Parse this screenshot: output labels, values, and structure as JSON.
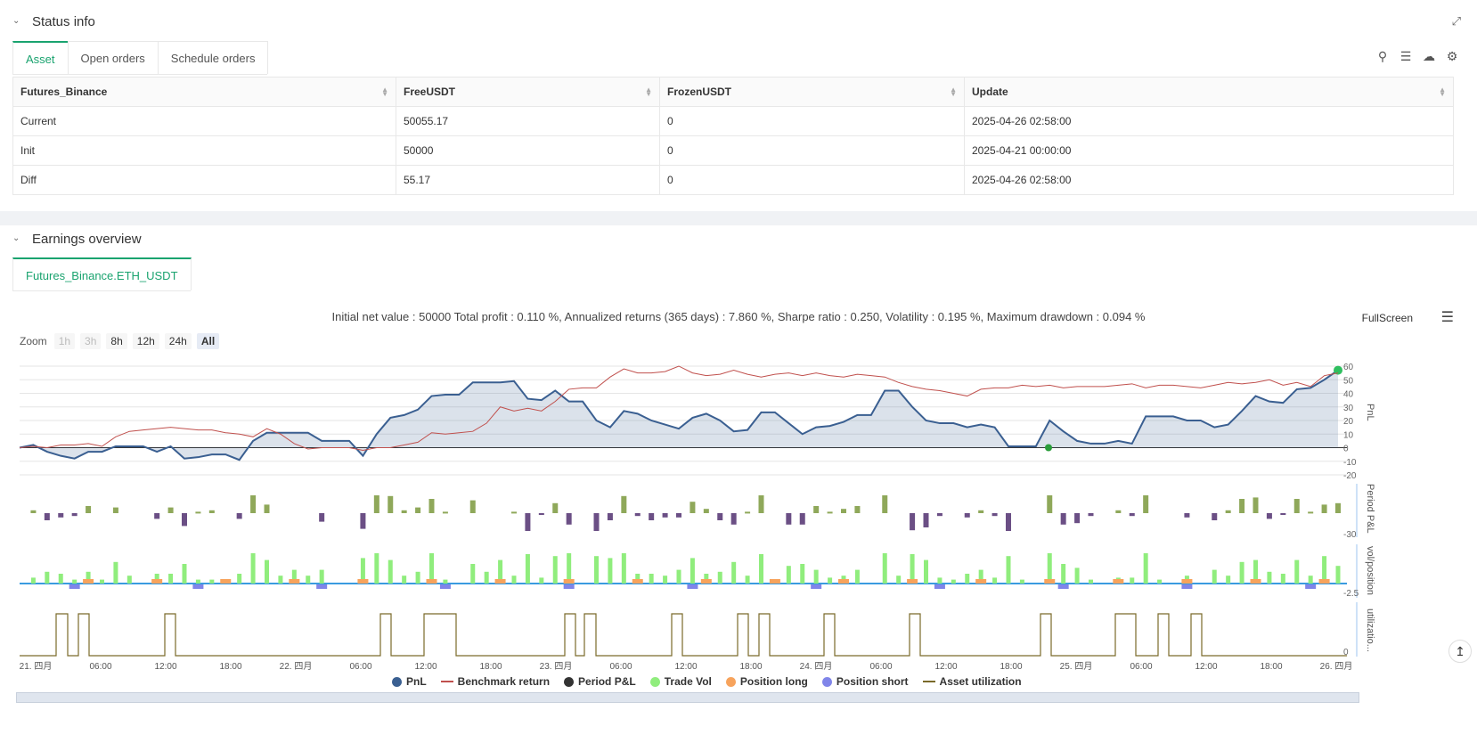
{
  "status": {
    "title": "Status info",
    "tabs": [
      {
        "label": "Asset",
        "active": true
      },
      {
        "label": "Open orders",
        "active": false
      },
      {
        "label": "Schedule orders",
        "active": false
      }
    ],
    "table": {
      "headers": [
        "Futures_Binance",
        "FreeUSDT",
        "FrozenUSDT",
        "Update"
      ],
      "rows": [
        [
          "Current",
          "50055.17",
          "0",
          "2025-04-26 02:58:00"
        ],
        [
          "Init",
          "50000",
          "0",
          "2025-04-21 00:00:00"
        ],
        [
          "Diff",
          "55.17",
          "0",
          "2025-04-26 02:58:00"
        ]
      ]
    }
  },
  "earnings": {
    "title": "Earnings overview",
    "tab": "Futures_Binance.ETH_USDT",
    "summary": "Initial net value : 50000 Total profit : 0.110 %, Annualized returns (365 days) : 7.860 %, Sharpe ratio : 0.250, Volatility : 0.195 %, Maximum drawdown : 0.094 %",
    "fullscreen": "FullScreen",
    "zoom_label": "Zoom",
    "zoom_buttons": [
      {
        "label": "1h",
        "state": "disabled"
      },
      {
        "label": "3h",
        "state": "disabled"
      },
      {
        "label": "8h",
        "state": "normal"
      },
      {
        "label": "12h",
        "state": "normal"
      },
      {
        "label": "24h",
        "state": "normal"
      },
      {
        "label": "All",
        "state": "selected"
      }
    ],
    "legend": [
      {
        "label": "PnL",
        "color": "#3a5f91",
        "shape": "dot"
      },
      {
        "label": "Benchmark return",
        "color": "#c0504d",
        "shape": "line"
      },
      {
        "label": "Period P&L",
        "color": "#333333",
        "shape": "dot"
      },
      {
        "label": "Trade Vol",
        "color": "#90ed7d",
        "shape": "dot"
      },
      {
        "label": "Position long",
        "color": "#f7a35c",
        "shape": "dot"
      },
      {
        "label": "Position short",
        "color": "#8085e9",
        "shape": "dot"
      },
      {
        "label": "Asset utilization",
        "color": "#7a6a2a",
        "shape": "line"
      }
    ]
  },
  "chart_data": {
    "type": "line",
    "x_ticks": [
      "21. 四月",
      "06:00",
      "12:00",
      "18:00",
      "22. 四月",
      "06:00",
      "12:00",
      "18:00",
      "23. 四月",
      "06:00",
      "12:00",
      "18:00",
      "24. 四月",
      "06:00",
      "12:00",
      "18:00",
      "25. 四月",
      "06:00",
      "12:00",
      "18:00",
      "26. 四月"
    ],
    "pnl_axis": {
      "label": "PnL",
      "ticks": [
        60,
        50,
        40,
        30,
        20,
        10,
        0,
        -10,
        -20
      ],
      "ylim": [
        -20,
        60
      ]
    },
    "period_axis": {
      "label": "Period P&L",
      "ticks": [
        -30
      ]
    },
    "vol_axis": {
      "label": "vol/position",
      "ticks": [
        -2.5
      ]
    },
    "util_axis": {
      "label": "utilizatio...",
      "ticks": [
        0
      ]
    },
    "pnl": [
      0,
      2,
      -3,
      -6,
      -8,
      -3,
      -3,
      1,
      1,
      1,
      -3,
      1,
      -8,
      -7,
      -5,
      -5,
      -9,
      5,
      11,
      11,
      11,
      11,
      5,
      5,
      5,
      -6,
      10,
      22,
      24,
      28,
      38,
      39,
      39,
      48,
      48,
      48,
      49,
      36,
      35,
      42,
      34,
      34,
      20,
      15,
      27,
      25,
      20,
      17,
      14,
      22,
      25,
      20,
      12,
      13,
      26,
      26,
      18,
      10,
      15,
      16,
      19,
      24,
      24,
      42,
      42,
      30,
      20,
      18,
      18,
      15,
      17,
      15,
      1,
      1,
      1,
      20,
      12,
      5,
      3,
      3,
      5,
      3,
      23,
      23,
      23,
      20,
      20,
      15,
      17,
      27,
      38,
      34,
      33,
      43,
      44,
      50,
      57
    ],
    "benchmark": [
      0,
      1,
      0,
      2,
      2,
      3,
      1,
      8,
      12,
      13,
      14,
      15,
      14,
      13,
      13,
      11,
      10,
      8,
      14,
      10,
      3,
      -1,
      0,
      0,
      0,
      -2,
      0,
      0,
      2,
      4,
      11,
      10,
      11,
      12,
      18,
      30,
      27,
      29,
      27,
      34,
      43,
      44,
      44,
      52,
      58,
      55,
      55,
      56,
      60,
      55,
      53,
      54,
      57,
      54,
      52,
      54,
      55,
      53,
      55,
      53,
      52,
      54,
      53,
      52,
      48,
      45,
      43,
      42,
      40,
      38,
      43,
      44,
      44,
      46,
      45,
      46,
      44,
      45,
      45,
      45,
      46,
      47,
      44,
      46,
      46,
      45,
      44,
      46,
      48,
      47,
      48,
      50,
      46,
      48,
      45,
      53,
      55
    ]
  }
}
